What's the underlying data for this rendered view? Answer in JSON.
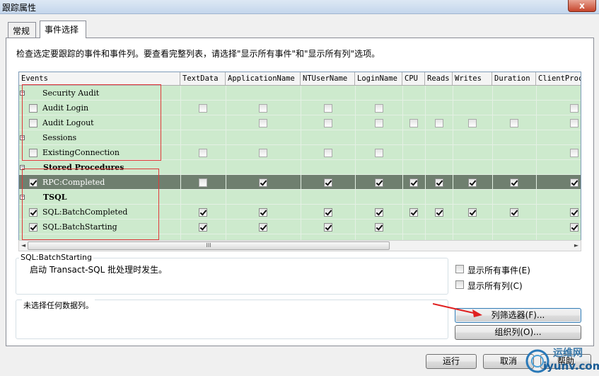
{
  "window": {
    "title": "跟踪属性",
    "close_glyph": "x"
  },
  "tabs": [
    {
      "label": "常规",
      "selected": false
    },
    {
      "label": "事件选择",
      "selected": true
    }
  ],
  "instruction": "检查选定要跟踪的事件和事件列。要查看完整列表，请选择\"显示所有事件\"和\"显示所有列\"选项。",
  "grid": {
    "columns": [
      "Events",
      "TextData",
      "ApplicationName",
      "NTUserName",
      "LoginName",
      "CPU",
      "Reads",
      "Writes",
      "Duration",
      "ClientProc"
    ],
    "rows": [
      {
        "label": "Security Audit",
        "type": "category",
        "expander": "−"
      },
      {
        "label": "Audit Login",
        "type": "event",
        "checked": false,
        "cols": [
          "off",
          "off",
          "off",
          "off",
          "",
          "",
          "",
          "",
          "off"
        ]
      },
      {
        "label": "Audit Logout",
        "type": "event",
        "checked": false,
        "cols": [
          "",
          "off",
          "off",
          "off",
          "off",
          "off",
          "off",
          "off",
          "off"
        ]
      },
      {
        "label": "Sessions",
        "type": "category",
        "expander": "−"
      },
      {
        "label": "ExistingConnection",
        "type": "event",
        "checked": false,
        "cols": [
          "off",
          "off",
          "off",
          "off",
          "",
          "",
          "",
          "",
          "off"
        ]
      },
      {
        "label": "Stored Procedures",
        "type": "category-bold",
        "expander": "−"
      },
      {
        "label": "RPC:Completed",
        "type": "event",
        "checked": true,
        "selected": true,
        "cols": [
          "off",
          "on",
          "on",
          "on",
          "on",
          "on",
          "on",
          "on",
          "on"
        ]
      },
      {
        "label": "TSQL",
        "type": "category-bold",
        "expander": "−"
      },
      {
        "label": "SQL:BatchCompleted",
        "type": "event",
        "checked": true,
        "cols": [
          "on",
          "on",
          "on",
          "on",
          "on",
          "on",
          "on",
          "on",
          "on"
        ]
      },
      {
        "label": "SQL:BatchStarting",
        "type": "event",
        "checked": true,
        "cols": [
          "on",
          "on",
          "on",
          "on",
          "",
          "",
          "",
          "",
          "on"
        ]
      }
    ],
    "scroll_grip": "III",
    "scroll_left": "◄",
    "scroll_right": "►"
  },
  "description": {
    "title": "SQL:BatchStarting",
    "text": "启动 Transact-SQL 批处理时发生。"
  },
  "options": {
    "show_all_events": "显示所有事件(E)",
    "show_all_columns": "显示所有列(C)"
  },
  "column_info": {
    "text": "未选择任何数据列。"
  },
  "buttons": {
    "column_filter": "列筛选器(F)...",
    "organize_columns": "组织列(O)...",
    "run": "运行",
    "cancel": "取消",
    "help": "帮助"
  },
  "watermark": {
    "top": "运维网",
    "bottom": "iyunv.com"
  },
  "colors": {
    "grid_bg": "#cdeacd",
    "selected_row": "#6f7f6f",
    "highlight": "#e03a3a"
  }
}
